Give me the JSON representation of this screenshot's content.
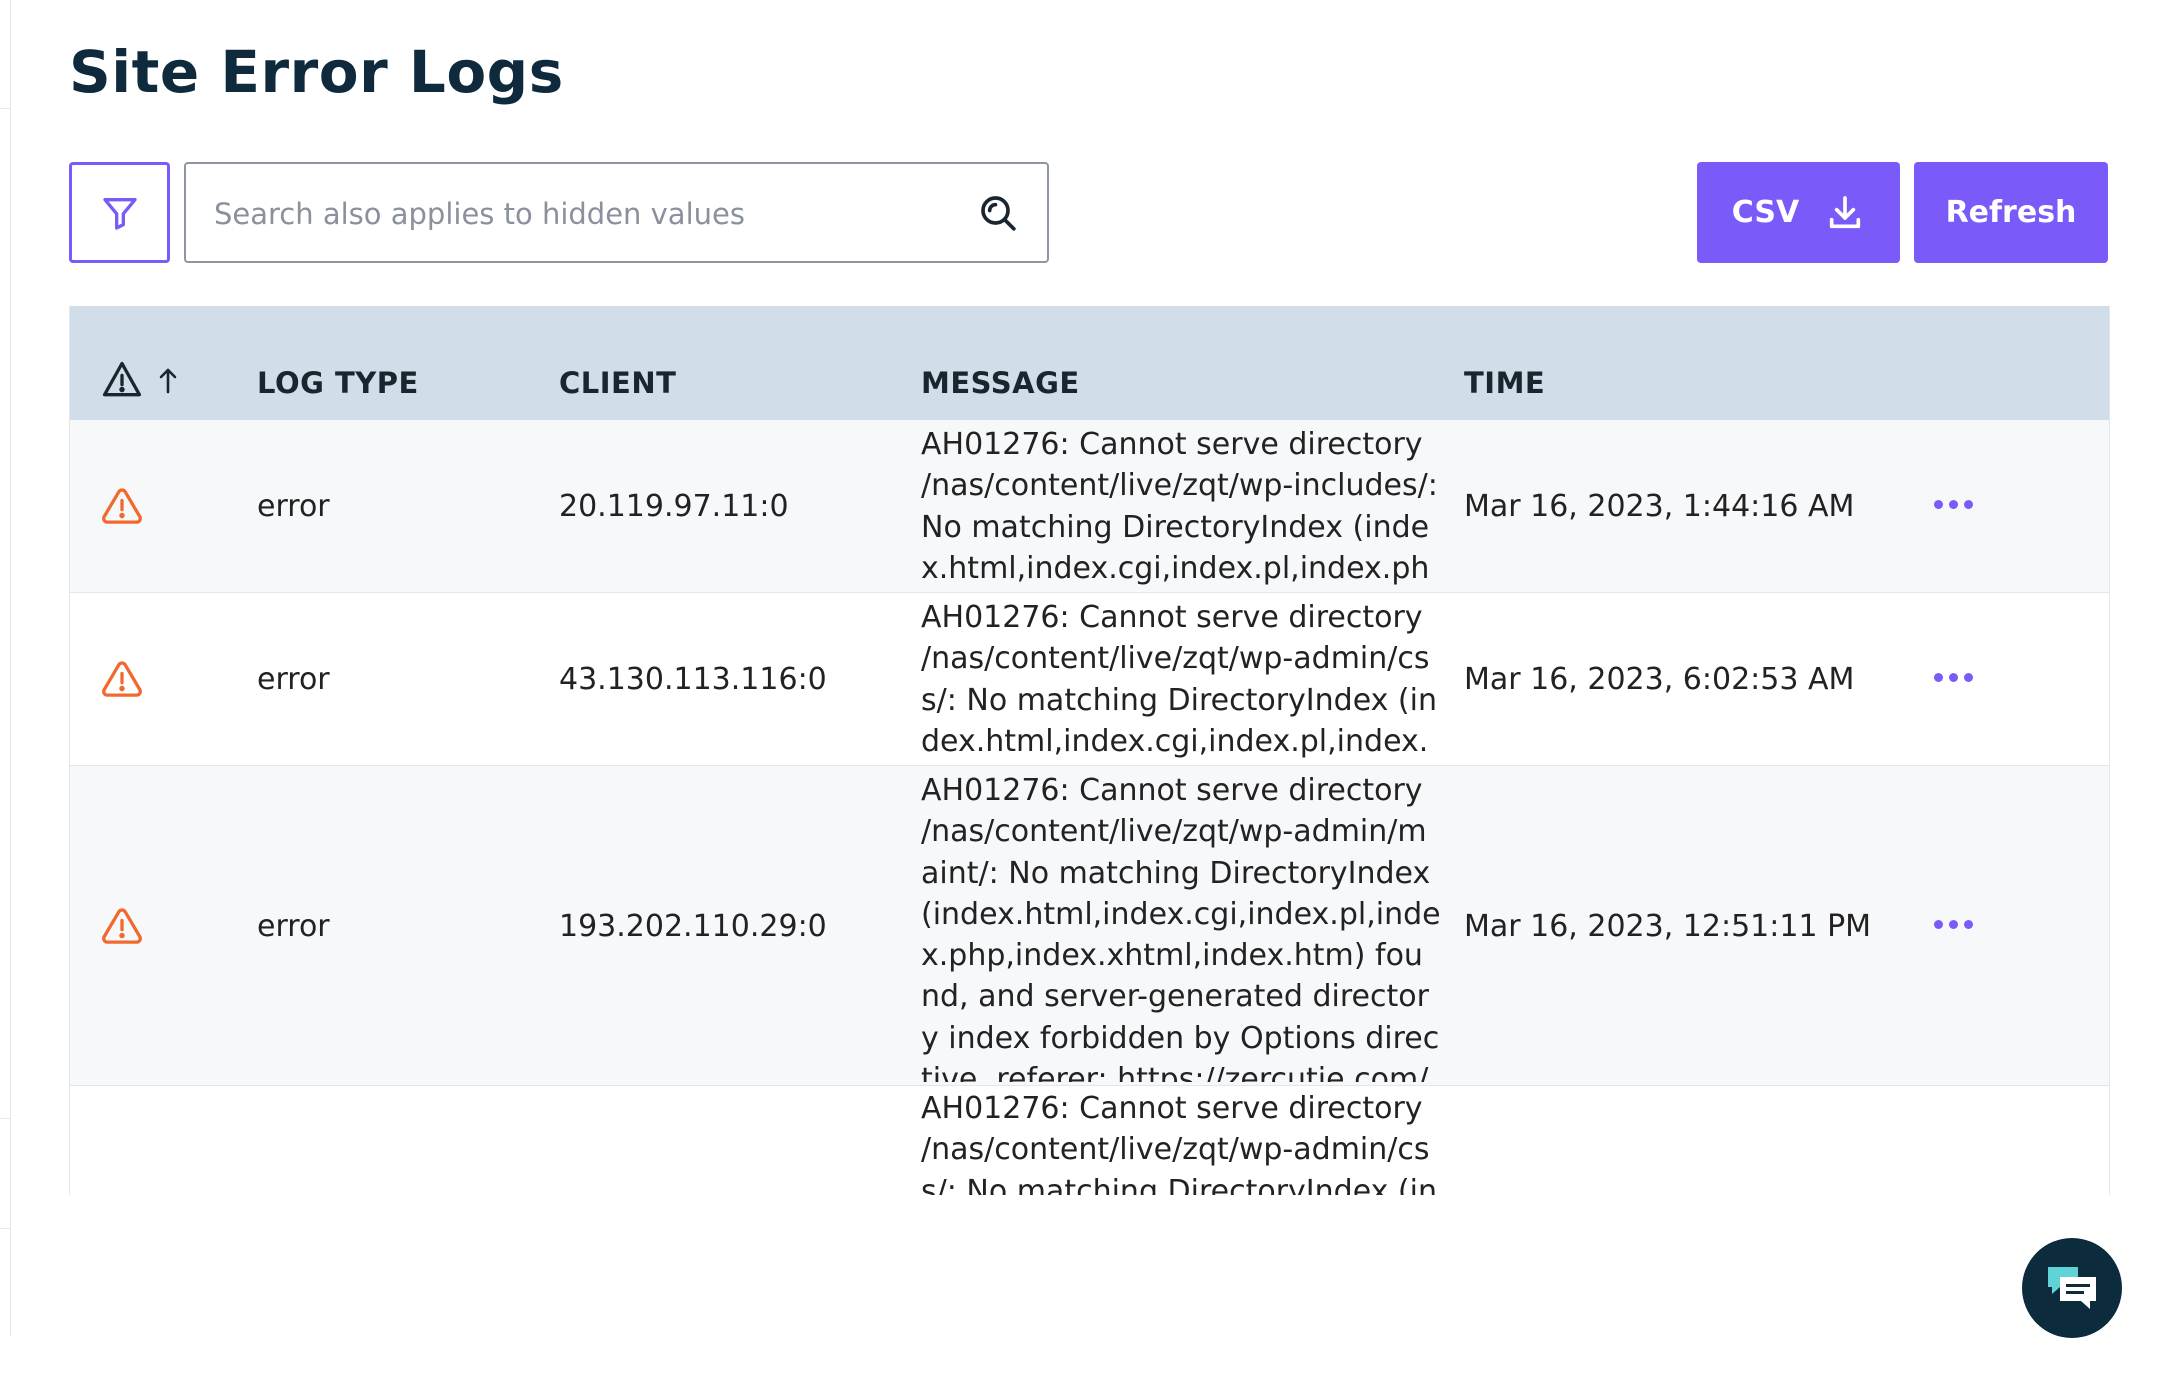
{
  "page": {
    "title": "Site Error Logs"
  },
  "toolbar": {
    "search_placeholder": "Search also applies to hidden values",
    "csv_label": "CSV",
    "refresh_label": "Refresh"
  },
  "table": {
    "columns": {
      "log_type": "LOG TYPE",
      "client": "CLIENT",
      "message": "MESSAGE",
      "time": "TIME"
    },
    "rows": [
      {
        "log_type": "error",
        "client": "20.119.97.11:0",
        "message": "AH01276: Cannot serve directory /nas/content/live/zqt/wp-includes/: No matching DirectoryIndex (index.html,index.cgi,index.pl,index.php,inde",
        "time": "Mar 16, 2023, 1:44:16 AM"
      },
      {
        "log_type": "error",
        "client": "43.130.113.116:0",
        "message": "AH01276: Cannot serve directory /nas/content/live/zqt/wp-admin/css/: No matching DirectoryIndex (index.html,index.cgi,index.pl,index.php,in",
        "time": "Mar 16, 2023, 6:02:53 AM"
      },
      {
        "log_type": "error",
        "client": "193.202.110.29:0",
        "message": "AH01276: Cannot serve directory /nas/content/live/zqt/wp-admin/maint/: No matching DirectoryIndex (index.html,index.cgi,index.pl,index.php,index.xhtml,index.htm) found, and server-generated directory index forbidden by Options directive, referer: https://zercutie.com/wp-admin/",
        "time": "Mar 16, 2023, 12:51:11 PM"
      },
      {
        "log_type": "",
        "client": "",
        "message": "AH01276: Cannot serve directory /nas/content/live/zqt/wp-admin/css/: No matching DirectoryIndex (index.",
        "time": ""
      }
    ]
  },
  "colors": {
    "accent": "#7a5af8",
    "title": "#0f2a3d",
    "header_bg": "#d1dde8",
    "severity_error": "#f06a2f",
    "chat_bg": "#0c2c3d"
  },
  "icons": [
    "filter-icon",
    "search-icon",
    "download-icon",
    "warning-icon",
    "sort-ascending-icon",
    "more-icon",
    "chat-icon"
  ]
}
